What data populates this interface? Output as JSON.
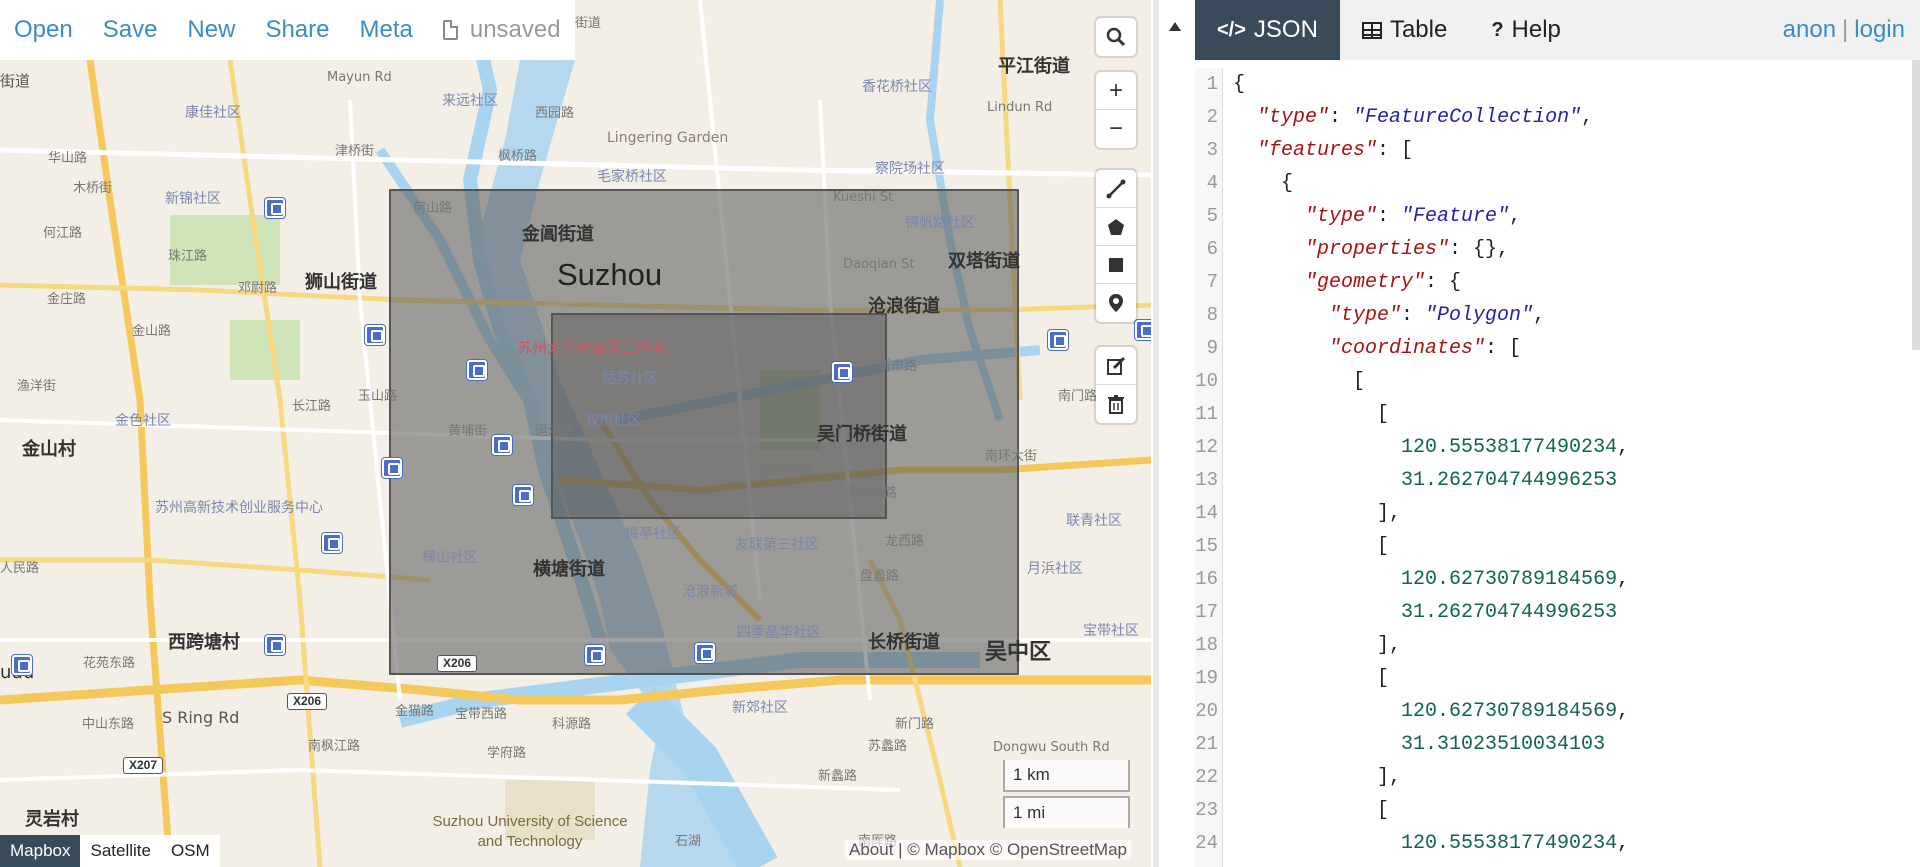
{
  "menu": {
    "open": "Open",
    "save": "Save",
    "new": "New",
    "share": "Share",
    "meta": "Meta",
    "unsaved": "unsaved"
  },
  "tabs": {
    "json": "JSON",
    "table": "Table",
    "help": "Help"
  },
  "user": {
    "anon": "anon",
    "separator": "|",
    "login": "login"
  },
  "map": {
    "city_label": "Suzhou",
    "labels": {
      "jietao_1": "街道",
      "mayun_rd": "Mayun Rd",
      "laiyuan": "来远社区",
      "xiyuan_lu": "西园路",
      "lingering_garden": "Lingering Garden",
      "xiangqiao": "香花桥社区",
      "pingjiang": "平江街道",
      "kangjia": "康佳社区",
      "huashan": "华山路",
      "jinqiao": "津桥街",
      "fengqiao": "枫桥路",
      "maojia": "毛家桥社区",
      "chayuan": "察院场社区",
      "lindun": "Lindun Rd",
      "mushan": "木桥街",
      "xinqiao": "新锦社区",
      "heshan_lu": "何山路",
      "jinchang": "金阊街道",
      "kueshi": "Kueshi St",
      "jinfan": "锦帆路社区",
      "shuangta": "双塔街道",
      "hejiang": "何江路",
      "zhujiang": "珠江路",
      "dengwei": "邓尉路",
      "shishan": "狮山街道",
      "daoqian": "Daoqian St",
      "canglang": "沧浪街道",
      "jinzhuang": "金庄路",
      "jinshan_lu": "金山路",
      "hospital": "苏州大学附属第二医院",
      "yushan": "玉山路",
      "gusu": "姑苏社区",
      "xinshi": "新市路",
      "nanmen": "南门路",
      "yuyang": "渔洋街",
      "jinse": "金色社区",
      "changjiang": "长江路",
      "huangpu": "黄埔街",
      "yunhe": "运河路",
      "shuangqiao": "双桥社区",
      "wumen": "吴门桥街道",
      "jinshan_village": "金山村",
      "nanhuan_street": "南环大街",
      "jiefang": "解放东路",
      "nanhuan_rd": "南环西路",
      "hengshan": "横山社区",
      "meiting": "梅亭社区",
      "youlian": "友联第三社区",
      "longxi": "龙西路",
      "lianhe": "联青社区",
      "suzhou_tech": "苏州高新技术创业服务中心",
      "hengtang": "横塘街道",
      "yuexing": "月浜社区",
      "canglangxin": "沧浪新城",
      "panli": "盘蠡路",
      "xikua": "西跨塘村",
      "sijing": "四季晶华社区",
      "changqiao": "长桥街道",
      "wuzhong": "吴中区",
      "baoshan": "宝带社区",
      "huayuan": "花苑东路",
      "zhongshan": "中山东路",
      "s_ring": "S Ring Rd",
      "jinmao": "金猫路",
      "baodai": "宝带西路",
      "keyuan": "科源路",
      "xinjiao": "新郊社区",
      "xinmen": "新门路",
      "nanfeng": "南枫江路",
      "xuefu": "学府路",
      "suli": "苏蠡路",
      "xinli": "新蠡路",
      "dongwu": "Dongwu South Rd",
      "lingyan": "灵岩村",
      "nanhou": "南厍路",
      "suzhou_univ": "Suzhou University of Science and Technology",
      "shihu": "石湖",
      "udu": "udu",
      "baoshi": "宝带社区",
      "x206": "X206",
      "x207": "X207"
    }
  },
  "layers": {
    "mapbox": "Mapbox",
    "satellite": "Satellite",
    "osm": "OSM"
  },
  "attribution": "About | © Mapbox © OpenStreetMap",
  "scale": {
    "km": "1 km",
    "mi": "1 mi"
  },
  "editor": {
    "lines": [
      [
        [
          "p",
          "{"
        ]
      ],
      [
        [
          "p",
          "  "
        ],
        [
          "k",
          "\"type\""
        ],
        [
          "p",
          ": "
        ],
        [
          "s",
          "\"FeatureCollection\""
        ],
        [
          "p",
          ","
        ]
      ],
      [
        [
          "p",
          "  "
        ],
        [
          "k",
          "\"features\""
        ],
        [
          "p",
          ": ["
        ]
      ],
      [
        [
          "p",
          "    {"
        ]
      ],
      [
        [
          "p",
          "      "
        ],
        [
          "k",
          "\"type\""
        ],
        [
          "p",
          ": "
        ],
        [
          "s",
          "\"Feature\""
        ],
        [
          "p",
          ","
        ]
      ],
      [
        [
          "p",
          "      "
        ],
        [
          "k",
          "\"properties\""
        ],
        [
          "p",
          ": {},"
        ]
      ],
      [
        [
          "p",
          "      "
        ],
        [
          "k",
          "\"geometry\""
        ],
        [
          "p",
          ": {"
        ]
      ],
      [
        [
          "p",
          "        "
        ],
        [
          "k",
          "\"type\""
        ],
        [
          "p",
          ": "
        ],
        [
          "s",
          "\"Polygon\""
        ],
        [
          "p",
          ","
        ]
      ],
      [
        [
          "p",
          "        "
        ],
        [
          "k",
          "\"coordinates\""
        ],
        [
          "p",
          ": ["
        ]
      ],
      [
        [
          "p",
          "          ["
        ]
      ],
      [
        [
          "p",
          "            ["
        ]
      ],
      [
        [
          "p",
          "              "
        ],
        [
          "n",
          "120.55538177490234"
        ],
        [
          "p",
          ","
        ]
      ],
      [
        [
          "p",
          "              "
        ],
        [
          "n",
          "31.262704744996253"
        ]
      ],
      [
        [
          "p",
          "            ],"
        ]
      ],
      [
        [
          "p",
          "            ["
        ]
      ],
      [
        [
          "p",
          "              "
        ],
        [
          "n",
          "120.62730789184569"
        ],
        [
          "p",
          ","
        ]
      ],
      [
        [
          "p",
          "              "
        ],
        [
          "n",
          "31.262704744996253"
        ]
      ],
      [
        [
          "p",
          "            ],"
        ]
      ],
      [
        [
          "p",
          "            ["
        ]
      ],
      [
        [
          "p",
          "              "
        ],
        [
          "n",
          "120.62730789184569"
        ],
        [
          "p",
          ","
        ]
      ],
      [
        [
          "p",
          "              "
        ],
        [
          "n",
          "31.31023510034103"
        ]
      ],
      [
        [
          "p",
          "            ],"
        ]
      ],
      [
        [
          "p",
          "            ["
        ]
      ],
      [
        [
          "p",
          "              "
        ],
        [
          "n",
          "120.55538177490234"
        ],
        [
          "p",
          ","
        ]
      ]
    ]
  }
}
